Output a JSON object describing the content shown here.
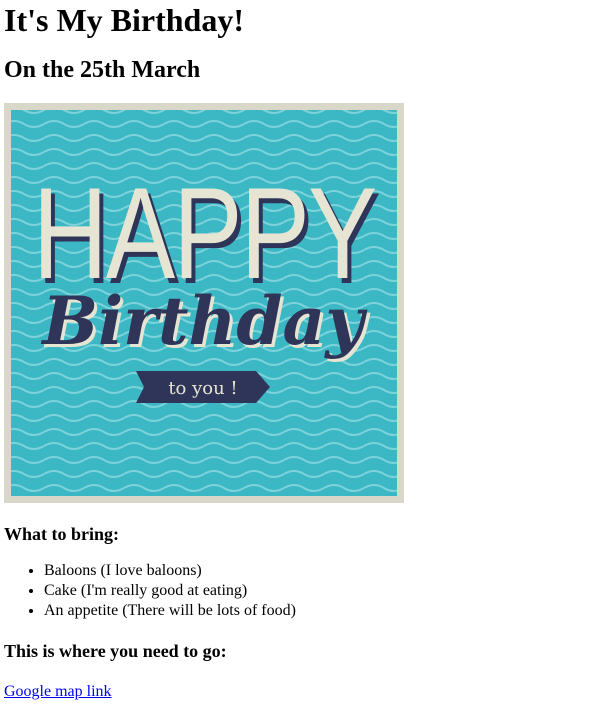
{
  "page": {
    "title": "It's My Birthday!",
    "subtitle": "On the 25th March"
  },
  "card": {
    "line1": "HAPPY",
    "line2": "Birthday",
    "line3": "to you !",
    "colors": {
      "border": "#d9d7c9",
      "teal": "#3bb8c4",
      "wave": "#7dd3da",
      "cream": "#e6e5d3",
      "navy": "#2f3558"
    }
  },
  "bring": {
    "heading": "What to bring:",
    "items": [
      "Baloons (I love baloons)",
      "Cake (I'm really good at eating)",
      "An appetite (There will be lots of food)"
    ]
  },
  "where": {
    "heading": "This is where you need to go:",
    "link_text": "Google map link"
  }
}
